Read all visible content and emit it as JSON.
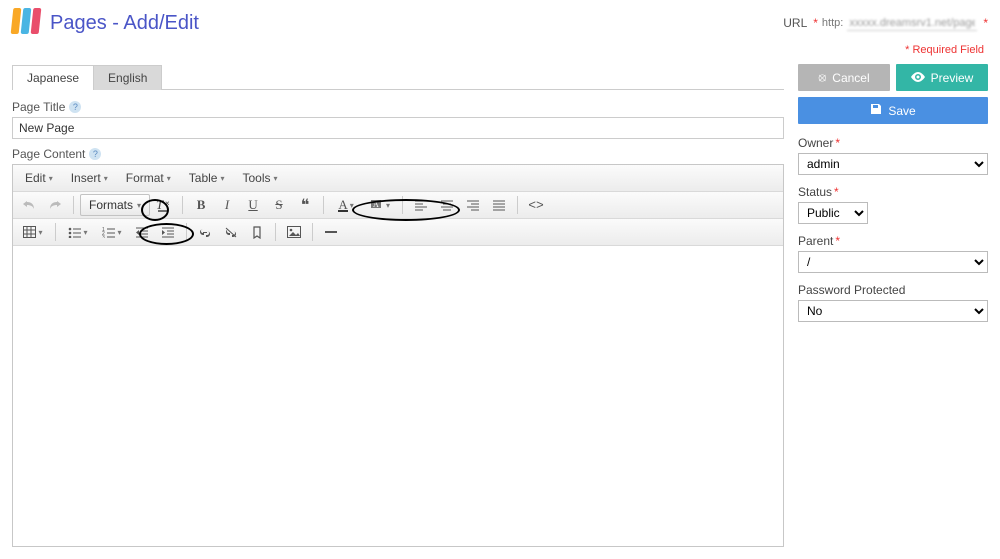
{
  "header": {
    "title": "Pages - Add/Edit",
    "url_label": "URL",
    "url_prefix": "http:",
    "url_value": "xxxxx.dreamsrv1.net/page/",
    "required_note": "* Required Field"
  },
  "tabs": {
    "japanese": "Japanese",
    "english": "English",
    "active": "english"
  },
  "form": {
    "page_title_label": "Page Title",
    "page_title_value": "New Page",
    "page_content_label": "Page Content"
  },
  "editor_menu": {
    "edit": "Edit",
    "insert": "Insert",
    "format": "Format",
    "table": "Table",
    "tools": "Tools"
  },
  "toolbar": {
    "formats_label": "Formats"
  },
  "sidebar": {
    "cancel": "Cancel",
    "preview": "Preview",
    "save": "Save",
    "owner_label": "Owner",
    "owner_value": "admin",
    "status_label": "Status",
    "status_value": "Public",
    "parent_label": "Parent",
    "parent_value": "/",
    "password_label": "Password Protected",
    "password_value": "No"
  }
}
